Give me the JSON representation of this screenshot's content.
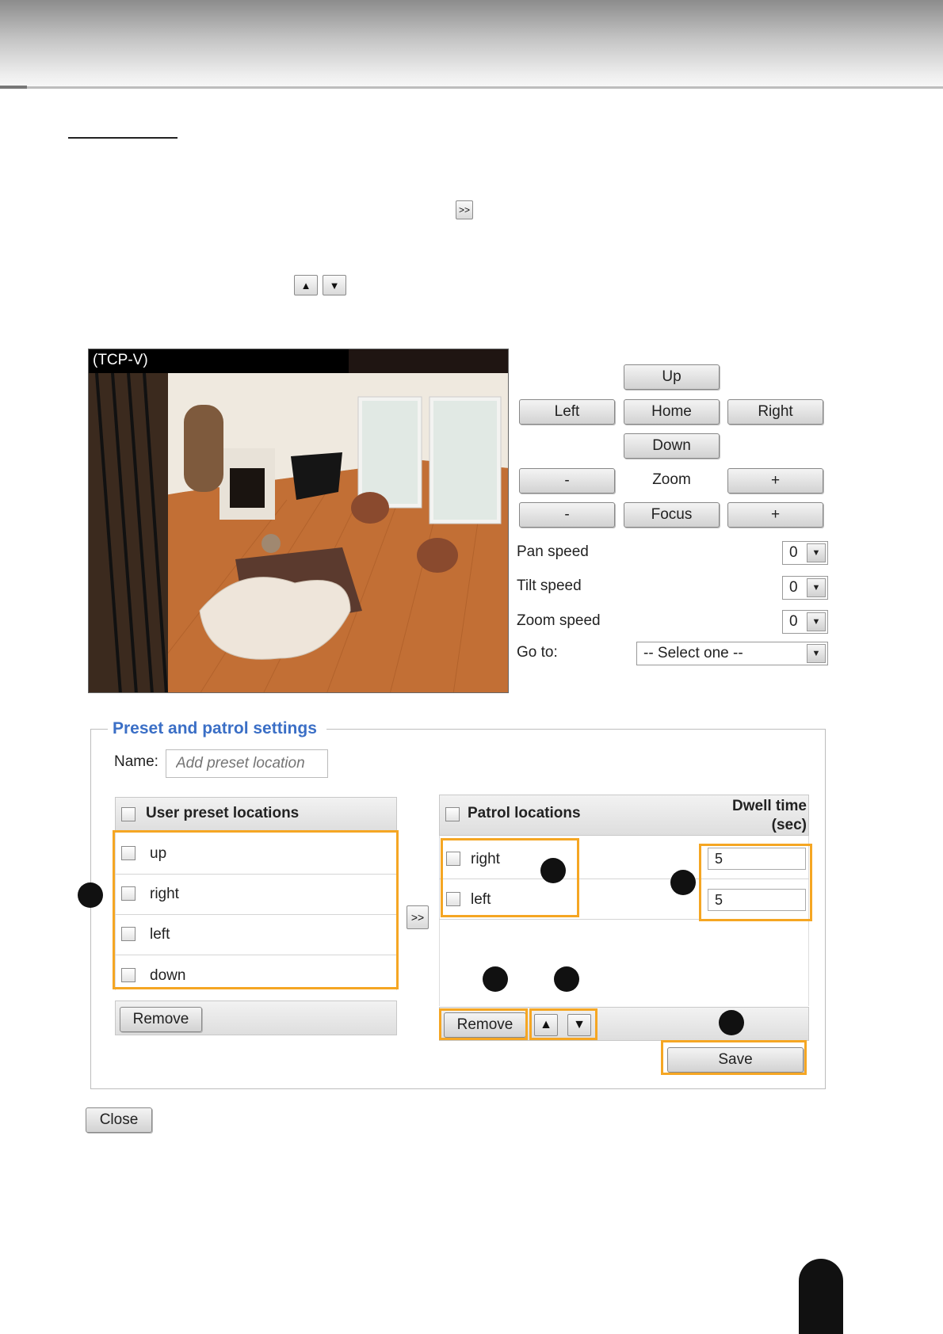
{
  "header_arrow_button": ">>",
  "up_down_buttons": {
    "up": "▲",
    "down": "▼"
  },
  "video": {
    "title": "(TCP-V)"
  },
  "ptz": {
    "up": "Up",
    "left": "Left",
    "home": "Home",
    "right": "Right",
    "down": "Down",
    "zoom_minus": "-",
    "zoom_label": "Zoom",
    "zoom_plus": "+",
    "focus_minus": "-",
    "focus_label": "Focus",
    "focus_plus": "+"
  },
  "speeds": {
    "pan_label": "Pan speed",
    "pan_value": "0",
    "tilt_label": "Tilt speed",
    "tilt_value": "0",
    "zoom_label": "Zoom speed",
    "zoom_value": "0"
  },
  "goto": {
    "label": "Go to:",
    "selected": "-- Select one --"
  },
  "preset": {
    "legend": "Preset and patrol settings",
    "name_label": "Name:",
    "name_placeholder": "Add preset location",
    "user_header": "User preset locations",
    "user_items": [
      "up",
      "right",
      "left",
      "down"
    ],
    "remove_label": "Remove",
    "move_label": ">>"
  },
  "patrol": {
    "header": "Patrol locations",
    "dwell_header_line1": "Dwell time",
    "dwell_header_line2": "(sec)",
    "items": [
      "right",
      "left"
    ],
    "dwell_values": [
      "5",
      "5"
    ],
    "remove_label": "Remove",
    "up_label": "▲",
    "down_label": "▼",
    "save_label": "Save"
  },
  "close_label": "Close",
  "colors": {
    "accent_orange": "#f5a623",
    "legend_blue": "#3b6fc6"
  }
}
